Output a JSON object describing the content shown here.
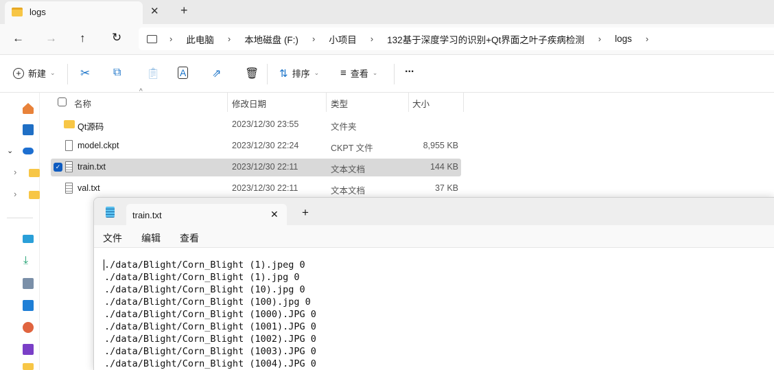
{
  "explorer": {
    "tab_title": "logs",
    "breadcrumb": [
      "此电脑",
      "本地磁盘 (F:)",
      "小项目",
      "132基于深度学习的识别+Qt界面之叶子疾病检测",
      "logs"
    ],
    "toolbar": {
      "new": "新建",
      "sort": "排序",
      "view": "查看",
      "more": "..."
    },
    "columns": {
      "name": "名称",
      "date": "修改日期",
      "type": "类型",
      "size": "大小"
    },
    "files": [
      {
        "name": "Qt源码",
        "date": "2023/12/30 23:55",
        "type": "文件夹",
        "size": "",
        "icon": "folder-icon"
      },
      {
        "name": "model.ckpt",
        "date": "2023/12/30 22:24",
        "type": "CKPT 文件",
        "size": "8,955 KB",
        "icon": "file-icon"
      },
      {
        "name": "train.txt",
        "date": "2023/12/30 22:11",
        "type": "文本文档",
        "size": "144 KB",
        "icon": "text-file-icon",
        "selected": true
      },
      {
        "name": "val.txt",
        "date": "2023/12/30 22:11",
        "type": "文本文档",
        "size": "37 KB",
        "icon": "text-file-icon"
      }
    ]
  },
  "notepad": {
    "tab_title": "train.txt",
    "menu": [
      "文件",
      "编辑",
      "查看"
    ],
    "lines": [
      "./data/Blight/Corn_Blight (1).jpeg 0",
      "./data/Blight/Corn_Blight (1).jpg 0",
      "./data/Blight/Corn_Blight (10).jpg 0",
      "./data/Blight/Corn_Blight (100).jpg 0",
      "./data/Blight/Corn_Blight (1000).JPG 0",
      "./data/Blight/Corn_Blight (1001).JPG 0",
      "./data/Blight/Corn_Blight (1002).JPG 0",
      "./data/Blight/Corn_Blight (1003).JPG 0",
      "./data/Blight/Corn_Blight (1004).JPG 0"
    ]
  }
}
